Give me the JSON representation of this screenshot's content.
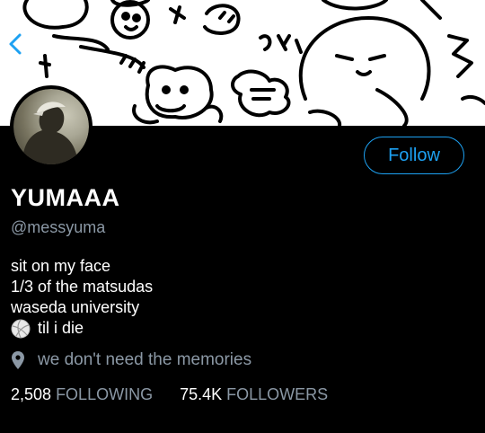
{
  "profile": {
    "display_name": "YUMAAA",
    "handle": "@messyuma",
    "bio_lines": [
      "sit on my face",
      "1/3 of the matsudas",
      "waseda university"
    ],
    "bio_last_line": "til i die",
    "location": "we don't need the memories",
    "follow_label": "Follow"
  },
  "stats": {
    "following_count": "2,508",
    "following_label": "FOLLOWING",
    "followers_count": "75.4K",
    "followers_label": "FOLLOWERS"
  },
  "icons": {
    "back": "chevron-left-icon",
    "location": "location-pin-icon",
    "bio_emoji": "volleyball-icon"
  },
  "colors": {
    "accent": "#1da1f2",
    "secondary_text": "#8b98a5",
    "background": "#000000"
  }
}
